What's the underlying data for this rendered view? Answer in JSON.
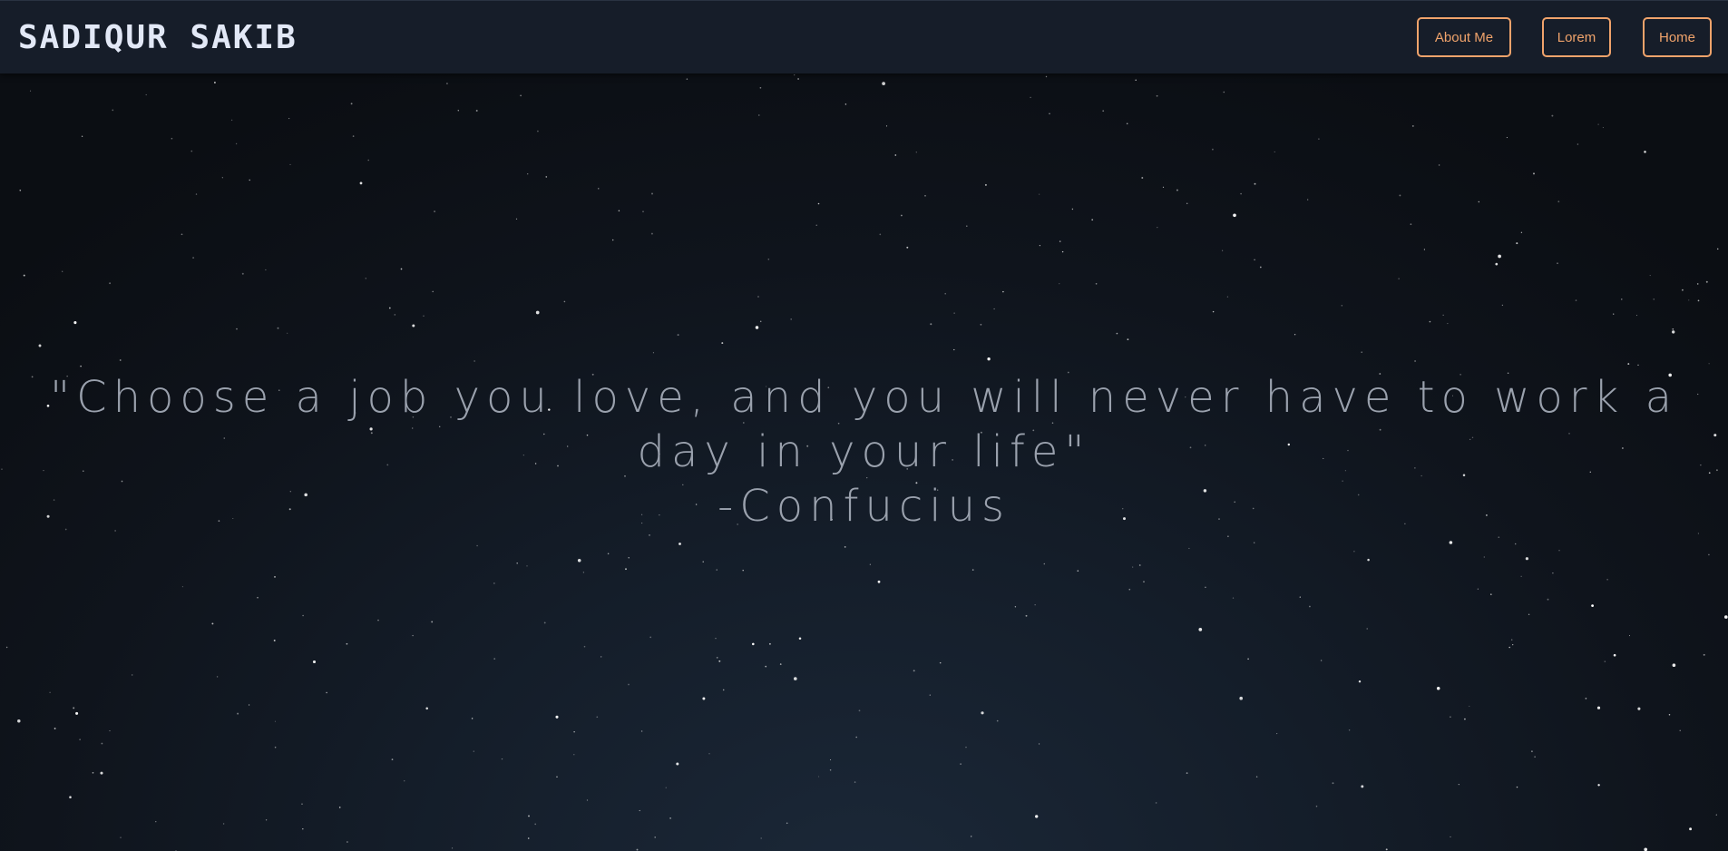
{
  "navbar": {
    "brand": "SADIQUR SAKIB",
    "links": [
      {
        "label": "About Me"
      },
      {
        "label": "Lorem"
      },
      {
        "label": "Home"
      }
    ]
  },
  "hero": {
    "quote": "\"Choose a job you love, and you will never have to work a day in your life\"",
    "author": "-Confucius"
  },
  "colors": {
    "accent": "#f0a36b",
    "brand_text": "#e2e8f6",
    "navbar_bg": "#161d29",
    "quote_text": "#9aa1ad",
    "star": "#ffffff"
  }
}
